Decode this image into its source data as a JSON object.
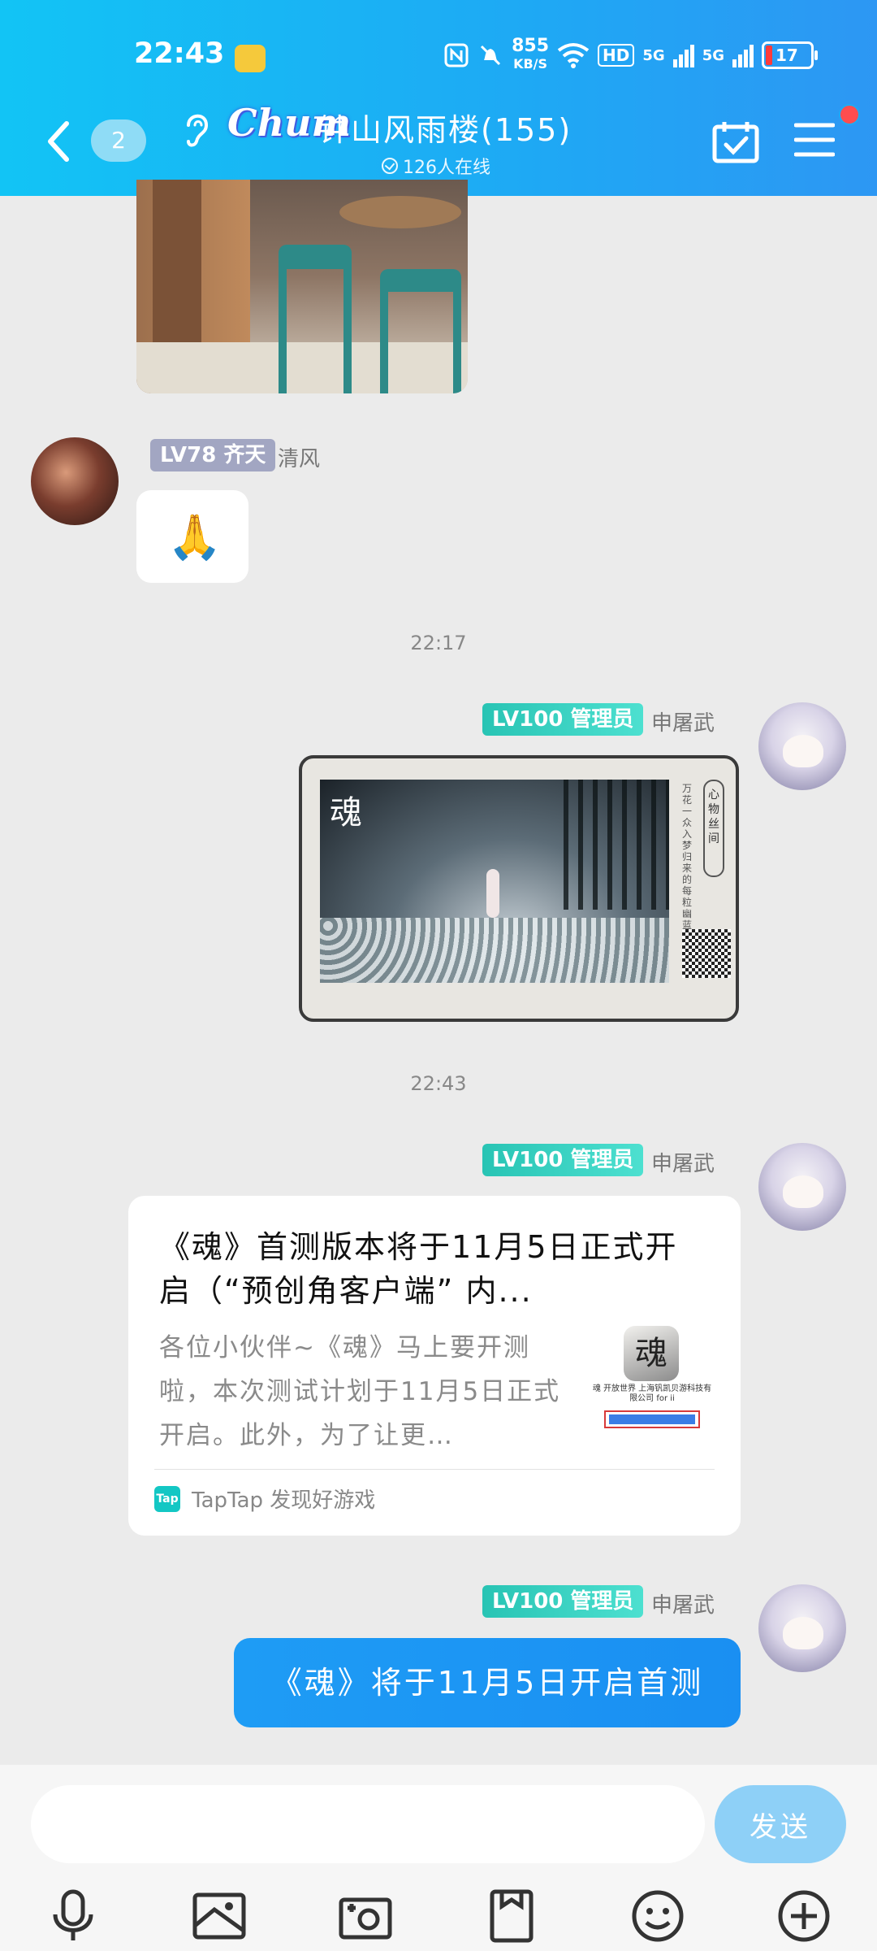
{
  "status_bar": {
    "time": "22:43",
    "net_speed_value": "855",
    "net_speed_unit": "KB/S",
    "hd_label": "HD",
    "sim1_label": "5G",
    "sim2_label": "5G",
    "battery": "17",
    "battery_color": "#ff3a3a"
  },
  "header": {
    "unread_count": "2",
    "logo_text": "Chum",
    "group_title": "钟山风雨楼(155)",
    "online_text": "126人在线",
    "accent_color": "#1ea9f4",
    "notification_dot_color": "#ff4d4f"
  },
  "messages": {
    "m2": {
      "level": "LV78 齐天",
      "sender": "清风",
      "sticker": "🙏"
    },
    "ts1": "22:17",
    "m3": {
      "level": "LV100 管理员",
      "sender": "申屠武",
      "image_logo": "魂",
      "image_side_text": "万花一众入梦归来的每粒幽蓝芳汤",
      "image_seal": "心物丝间"
    },
    "ts2": "22:43",
    "m4": {
      "level": "LV100 管理员",
      "sender": "申屠武",
      "title": "《魂》首测版本将于11月5日正式开启（“预创角客户端” 内...",
      "description": "各位小伙伴~《魂》马上要开测啦，本次测试计划于11月5日正式开启。此外，为了让更…",
      "thumb_icon": "魂",
      "thumb_caption": "魂 开放世界\n上海钒凯贝游科技有限公司 for ii",
      "source_logo": "Tap",
      "source": "TapTap 发现好游戏"
    },
    "m5": {
      "level": "LV100 管理员",
      "sender": "申屠武",
      "text": "《魂》将于11月5日开启首测"
    }
  },
  "composer": {
    "placeholder": "",
    "send_label": "发送",
    "send_color": "#8ed0f7"
  },
  "toolbar": {
    "items": [
      "mic-icon",
      "image-icon",
      "camera-icon",
      "file-icon",
      "emoji-icon",
      "plus-icon"
    ]
  }
}
